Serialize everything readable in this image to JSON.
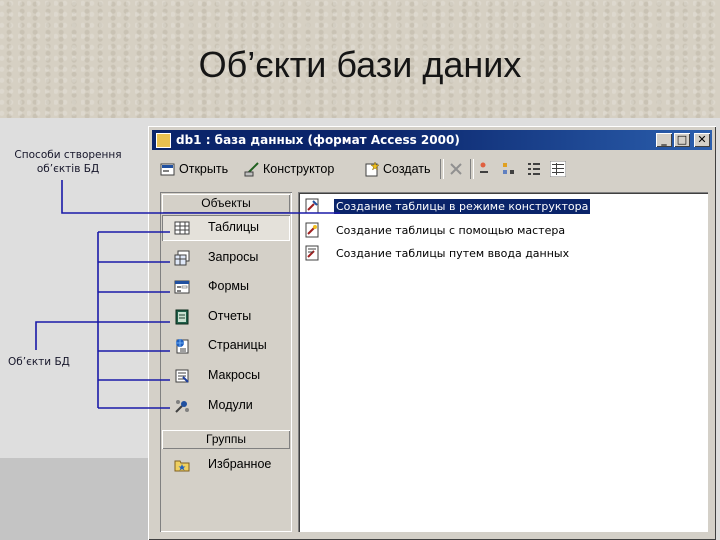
{
  "slide": {
    "title": "Об’єкти бази даних",
    "annotation_create": "Способи створення об’єктів БД",
    "annotation_objects": "Об’єкти БД"
  },
  "window": {
    "title": "db1 : база данных (формат Access 2000)",
    "controls": {
      "minimize": "_",
      "maximize": "□",
      "close": "✕"
    }
  },
  "toolbar": {
    "open_label": "Открыть",
    "design_label": "Конструктор",
    "create_label": "Создать"
  },
  "objects_bar": {
    "objects_header": "Объекты",
    "items": [
      {
        "label": "Таблицы",
        "icon": "table-icon"
      },
      {
        "label": "Запросы",
        "icon": "query-icon"
      },
      {
        "label": "Формы",
        "icon": "form-icon"
      },
      {
        "label": "Отчеты",
        "icon": "report-icon"
      },
      {
        "label": "Страницы",
        "icon": "page-icon"
      },
      {
        "label": "Макросы",
        "icon": "macro-icon"
      },
      {
        "label": "Модули",
        "icon": "module-icon"
      }
    ],
    "groups_header": "Группы",
    "groups": [
      {
        "label": "Избранное",
        "icon": "favorites-folder-icon"
      }
    ]
  },
  "list": {
    "items": [
      "Создание таблицы в режиме конструктора",
      "Создание таблицы с помощью мастера",
      "Создание таблицы путем ввода данных"
    ]
  },
  "colors": {
    "titlebar": "#0a246a",
    "selection": "#0a246a",
    "connector_lines": "#1a1aa8"
  }
}
